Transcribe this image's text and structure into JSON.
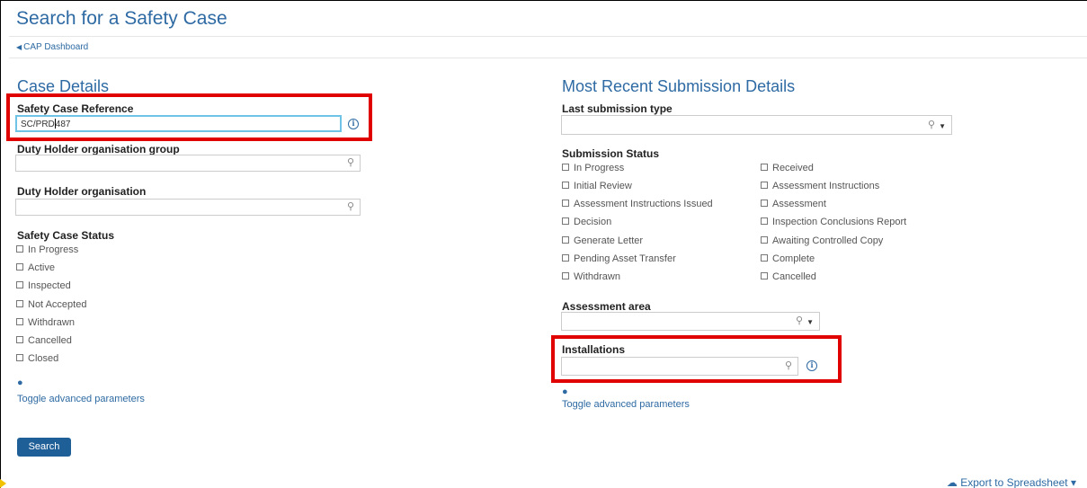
{
  "page": {
    "title": "Search for a Safety Case",
    "back_link": "CAP Dashboard"
  },
  "left": {
    "section_title": "Case Details",
    "safety_case_reference": {
      "label": "Safety Case Reference",
      "value_before_caret": "SC/PRD",
      "value_after_caret": "487"
    },
    "duty_holder_group": {
      "label": "Duty Holder organisation group",
      "value": ""
    },
    "duty_holder_org": {
      "label": "Duty Holder organisation",
      "value": ""
    },
    "status": {
      "label": "Safety Case Status",
      "options": [
        "In Progress",
        "Active",
        "Inspected",
        "Not Accepted",
        "Withdrawn",
        "Cancelled",
        "Closed"
      ]
    },
    "toggle_label": "Toggle advanced parameters",
    "search_button": "Search"
  },
  "right": {
    "section_title": "Most Recent Submission Details",
    "last_submission_type": {
      "label": "Last submission type",
      "value": ""
    },
    "submission_status": {
      "label": "Submission Status",
      "col1": [
        "In Progress",
        "Initial Review",
        "Assessment Instructions Issued",
        "Decision",
        "Generate Letter",
        "Pending Asset Transfer",
        "Withdrawn"
      ],
      "col2": [
        "Received",
        "Assessment Instructions",
        "Assessment",
        "Inspection Conclusions Report",
        "Awaiting Controlled Copy",
        "Complete",
        "Cancelled"
      ]
    },
    "assessment_area": {
      "label": "Assessment area",
      "value": ""
    },
    "installations": {
      "label": "Installations",
      "value": ""
    },
    "toggle_label": "Toggle advanced parameters"
  },
  "export": {
    "label": "Export to Spreadsheet"
  },
  "icons": {
    "search": "🔍",
    "info": "i",
    "eye": "👁",
    "dropdown": "▾",
    "back": "◀",
    "export": "☁"
  },
  "colors": {
    "accent": "#2e6aa3",
    "highlight": "#e00000",
    "button": "#1f5f98"
  }
}
